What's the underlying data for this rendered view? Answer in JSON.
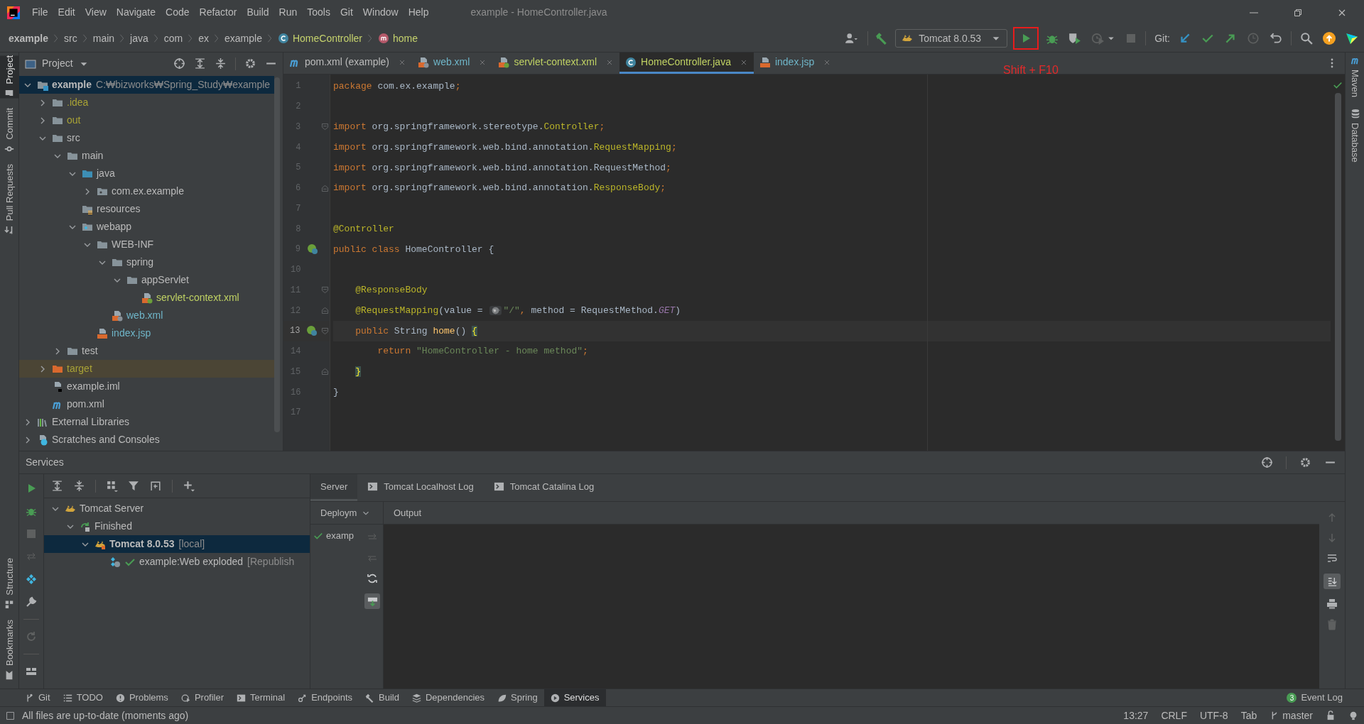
{
  "window": {
    "title": "example - HomeController.java"
  },
  "menu": [
    "File",
    "Edit",
    "View",
    "Navigate",
    "Code",
    "Refactor",
    "Build",
    "Run",
    "Tools",
    "Git",
    "Window",
    "Help"
  ],
  "breadcrumbs": [
    {
      "label": "example",
      "kind": "project"
    },
    {
      "label": "src",
      "kind": "folder"
    },
    {
      "label": "main",
      "kind": "folder"
    },
    {
      "label": "java",
      "kind": "folder"
    },
    {
      "label": "com",
      "kind": "folder"
    },
    {
      "label": "ex",
      "kind": "folder"
    },
    {
      "label": "example",
      "kind": "folder"
    },
    {
      "label": "HomeController",
      "kind": "class"
    },
    {
      "label": "home",
      "kind": "method"
    }
  ],
  "toolbar": {
    "run_configuration": "Tomcat 8.0.53",
    "git_label": "Git:",
    "run_highlighted": true,
    "annotation": "Shift + F10"
  },
  "left_stripe": {
    "top": [
      {
        "label": "Project",
        "kind": "project",
        "selected": true
      },
      {
        "label": "Commit",
        "kind": "commit",
        "selected": false
      },
      {
        "label": "Pull Requests",
        "kind": "pull",
        "selected": false
      }
    ],
    "bottom": [
      {
        "label": "Structure",
        "kind": "structure",
        "selected": false
      },
      {
        "label": "Bookmarks",
        "kind": "bookmarks",
        "selected": false
      }
    ]
  },
  "right_stripe": [
    {
      "label": "Maven",
      "kind": "maven"
    },
    {
      "label": "Database",
      "kind": "database"
    }
  ],
  "project_panel": {
    "title": "Project",
    "tree": [
      {
        "label": "example",
        "note": "C:₩bizworks₩Spring_Study₩example",
        "kind": "module",
        "expanded": true,
        "selected": true,
        "highlighted": false,
        "children": [
          {
            "label": ".idea",
            "kind": "folder",
            "expanded": false,
            "selected": false,
            "highlighted": false,
            "color": "#a8a236"
          },
          {
            "label": "out",
            "kind": "folder",
            "expanded": false,
            "selected": false,
            "highlighted": false,
            "color": "#a8a236"
          },
          {
            "label": "src",
            "kind": "folder",
            "expanded": true,
            "selected": false,
            "highlighted": false,
            "color": "#bbbbbb",
            "children": [
              {
                "label": "main",
                "kind": "folder",
                "expanded": true,
                "selected": false,
                "highlighted": false,
                "color": "#bbbbbb",
                "children": [
                  {
                    "label": "java",
                    "kind": "source",
                    "expanded": true,
                    "selected": false,
                    "highlighted": false,
                    "color": "#bbbbbb",
                    "children": [
                      {
                        "label": "com.ex.example",
                        "kind": "package",
                        "expanded": false,
                        "selected": false,
                        "highlighted": false,
                        "color": "#bbbbbb"
                      }
                    ]
                  },
                  {
                    "label": "resources",
                    "kind": "resources",
                    "selected": false,
                    "highlighted": false,
                    "color": "#bbbbbb"
                  },
                  {
                    "label": "webapp",
                    "kind": "webapp",
                    "expanded": true,
                    "selected": false,
                    "highlighted": false,
                    "color": "#bbbbbb",
                    "children": [
                      {
                        "label": "WEB-INF",
                        "kind": "folder",
                        "expanded": true,
                        "selected": false,
                        "highlighted": false,
                        "color": "#bbbbbb",
                        "children": [
                          {
                            "label": "spring",
                            "kind": "folder",
                            "expanded": true,
                            "selected": false,
                            "highlighted": false,
                            "color": "#bbbbbb",
                            "children": [
                              {
                                "label": "appServlet",
                                "kind": "folder",
                                "expanded": true,
                                "selected": false,
                                "highlighted": false,
                                "color": "#bbbbbb",
                                "children": [
                                  {
                                    "label": "servlet-context.xml",
                                    "kind": "spring_xml",
                                    "selected": false,
                                    "highlighted": false,
                                    "color": "#bfd163"
                                  }
                                ]
                              }
                            ]
                          },
                          {
                            "label": "web.xml",
                            "kind": "web_xml",
                            "selected": false,
                            "highlighted": false,
                            "color": "#6fb5c8"
                          }
                        ]
                      },
                      {
                        "label": "index.jsp",
                        "kind": "jsp",
                        "selected": false,
                        "highlighted": false,
                        "color": "#6fb5c8"
                      }
                    ]
                  }
                ]
              },
              {
                "label": "test",
                "kind": "folder",
                "expanded": false,
                "selected": false,
                "highlighted": false,
                "color": "#bbbbbb"
              }
            ]
          },
          {
            "label": "target",
            "kind": "excluded",
            "expanded": false,
            "selected": false,
            "highlighted": true,
            "color": "#a8a236"
          },
          {
            "label": "example.iml",
            "kind": "iml",
            "selected": false,
            "highlighted": false,
            "color": "#bbbbbb"
          },
          {
            "label": "pom.xml",
            "kind": "maven",
            "selected": false,
            "highlighted": false,
            "color": "#bbbbbb"
          }
        ]
      },
      {
        "label": "External Libraries",
        "kind": "libraries",
        "expanded": false,
        "selected": false,
        "highlighted": false,
        "color": "#bbbbbb"
      },
      {
        "label": "Scratches and Consoles",
        "kind": "scratches",
        "expanded": false,
        "selected": false,
        "highlighted": false,
        "color": "#bbbbbb"
      }
    ]
  },
  "editor_tabs": [
    {
      "label": "pom.xml (example)",
      "kind": "maven",
      "color": "#bbbbbb",
      "selected": false
    },
    {
      "label": "web.xml",
      "kind": "web_xml",
      "color": "#6fb5c8",
      "selected": false
    },
    {
      "label": "servlet-context.xml",
      "kind": "spring_xml",
      "color": "#bfd163",
      "selected": false
    },
    {
      "label": "HomeController.java",
      "kind": "class",
      "color": "#bfd163",
      "selected": true
    },
    {
      "label": "index.jsp",
      "kind": "jsp",
      "color": "#6fb5c8",
      "selected": false
    }
  ],
  "code": [
    {
      "number": "1",
      "current": false,
      "bean": false,
      "fold_start": false,
      "fold_end": false,
      "tokens": [
        {
          "kind": "keyword",
          "text": "package"
        },
        {
          "kind": "plain",
          "text": " com.ex.example"
        },
        {
          "kind": "keyword",
          "text": ";"
        }
      ]
    },
    {
      "number": "2",
      "current": false,
      "bean": false,
      "fold_start": false,
      "fold_end": false
    },
    {
      "number": "3",
      "current": false,
      "bean": false,
      "fold_start": true,
      "fold_end": false,
      "tokens": [
        {
          "kind": "keyword",
          "text": "import"
        },
        {
          "kind": "plain",
          "text": " org.springframework.stereotype."
        },
        {
          "kind": "annotation",
          "text": "Controller"
        },
        {
          "kind": "keyword",
          "text": ";"
        }
      ]
    },
    {
      "number": "4",
      "current": false,
      "bean": false,
      "fold_start": false,
      "fold_end": false,
      "tokens": [
        {
          "kind": "keyword",
          "text": "import"
        },
        {
          "kind": "plain",
          "text": " org.springframework.web.bind.annotation."
        },
        {
          "kind": "annotation",
          "text": "RequestMapping"
        },
        {
          "kind": "keyword",
          "text": ";"
        }
      ]
    },
    {
      "number": "5",
      "current": false,
      "bean": false,
      "fold_start": false,
      "fold_end": false,
      "tokens": [
        {
          "kind": "keyword",
          "text": "import"
        },
        {
          "kind": "plain",
          "text": " org.springframework.web.bind.annotation.RequestMethod"
        },
        {
          "kind": "keyword",
          "text": ";"
        }
      ]
    },
    {
      "number": "6",
      "current": false,
      "bean": false,
      "fold_start": false,
      "fold_end": true,
      "tokens": [
        {
          "kind": "keyword",
          "text": "import"
        },
        {
          "kind": "plain",
          "text": " org.springframework.web.bind.annotation."
        },
        {
          "kind": "annotation",
          "text": "ResponseBody"
        },
        {
          "kind": "keyword",
          "text": ";"
        }
      ]
    },
    {
      "number": "7",
      "current": false,
      "bean": false,
      "fold_start": false,
      "fold_end": false
    },
    {
      "number": "8",
      "current": false,
      "bean": false,
      "fold_start": false,
      "fold_end": false,
      "tokens": [
        {
          "kind": "annotation",
          "text": "@Controller"
        }
      ]
    },
    {
      "number": "9",
      "current": false,
      "bean": true,
      "fold_start": false,
      "fold_end": false,
      "tokens": [
        {
          "kind": "keyword",
          "text": "public class"
        },
        {
          "kind": "plain",
          "text": " HomeController {"
        }
      ]
    },
    {
      "number": "10",
      "current": false,
      "bean": false,
      "fold_start": false,
      "fold_end": false
    },
    {
      "number": "11",
      "current": false,
      "bean": false,
      "fold_start": true,
      "fold_end": false,
      "tokens": [
        {
          "kind": "annotation",
          "text": "    @ResponseBody"
        }
      ]
    },
    {
      "number": "12",
      "current": false,
      "bean": false,
      "fold_start": false,
      "fold_end": true,
      "tokens": [
        {
          "kind": "annotation",
          "text": "    @RequestMapping"
        },
        {
          "kind": "plain",
          "text": "(value = "
        },
        {
          "kind": "url_hint"
        },
        {
          "kind": "string",
          "text": "\"/\""
        },
        {
          "kind": "keyword",
          "text": ","
        },
        {
          "kind": "plain",
          "text": " method = RequestMethod."
        },
        {
          "kind": "constant",
          "text": "GET"
        },
        {
          "kind": "plain",
          "text": ")"
        }
      ]
    },
    {
      "number": "13",
      "current": true,
      "bean": true,
      "fold_start": true,
      "fold_end": false,
      "tokens": [
        {
          "kind": "keyword",
          "text": "    public"
        },
        {
          "kind": "plain",
          "text": " String "
        },
        {
          "kind": "method",
          "text": "home"
        },
        {
          "kind": "plain",
          "text": "() "
        },
        {
          "kind": "brace",
          "text": "{"
        }
      ]
    },
    {
      "number": "14",
      "current": false,
      "bean": false,
      "fold_start": false,
      "fold_end": false,
      "tokens": [
        {
          "kind": "keyword",
          "text": "        return "
        },
        {
          "kind": "string",
          "text": "\"HomeController - home method\""
        },
        {
          "kind": "keyword",
          "text": ";"
        }
      ]
    },
    {
      "number": "15",
      "current": false,
      "bean": false,
      "fold_start": false,
      "fold_end": true,
      "tokens": [
        {
          "kind": "brace",
          "text": "    }"
        }
      ]
    },
    {
      "number": "16",
      "current": false,
      "bean": false,
      "fold_start": false,
      "fold_end": false,
      "tokens": [
        {
          "kind": "plain",
          "text": "}"
        }
      ]
    },
    {
      "number": "17",
      "current": false,
      "bean": false,
      "fold_start": false,
      "fold_end": false
    }
  ],
  "services": {
    "title": "Services",
    "tree": [
      {
        "label": "Tomcat Server",
        "kind": "server",
        "expanded": true,
        "selected": false,
        "children": [
          {
            "label": "Finished",
            "kind": "finished",
            "expanded": true,
            "selected": false,
            "children": [
              {
                "label": "Tomcat 8.0.53",
                "note": "[local]",
                "kind": "tomcat",
                "expanded": true,
                "selected": true,
                "children": [
                  {
                    "label": "example:Web exploded",
                    "note": "[Republish",
                    "kind": "artifact",
                    "selected": false
                  }
                ]
              }
            ]
          }
        ]
      }
    ],
    "tabs": [
      {
        "label": "Server",
        "kind": "server",
        "selected": true
      },
      {
        "label": "Tomcat Localhost Log",
        "kind": "log",
        "selected": false
      },
      {
        "label": "Tomcat Catalina Log",
        "kind": "log",
        "selected": false
      }
    ],
    "deployment_header": "Deploym",
    "deployments": [
      {
        "label": "examp",
        "deployed": true
      }
    ],
    "output_header": "Output"
  },
  "tool_windows": [
    {
      "label": "Git",
      "kind": "git",
      "selected": false
    },
    {
      "label": "TODO",
      "kind": "todo",
      "selected": false
    },
    {
      "label": "Problems",
      "kind": "problems",
      "selected": false
    },
    {
      "label": "Profiler",
      "kind": "profiler",
      "selected": false
    },
    {
      "label": "Terminal",
      "kind": "terminal",
      "selected": false
    },
    {
      "label": "Endpoints",
      "kind": "endpoints",
      "selected": false
    },
    {
      "label": "Build",
      "kind": "build",
      "selected": false
    },
    {
      "label": "Dependencies",
      "kind": "dependencies",
      "selected": false
    },
    {
      "label": "Spring",
      "kind": "spring",
      "selected": false
    },
    {
      "label": "Services",
      "kind": "services",
      "selected": true
    }
  ],
  "event_log": {
    "label": "Event Log",
    "count": "3"
  },
  "status_bar": {
    "message": "All files are up-to-date (moments ago)",
    "position": "13:27",
    "line_separator": "CRLF",
    "encoding": "UTF-8",
    "indent": "Tab",
    "branch": "master"
  }
}
